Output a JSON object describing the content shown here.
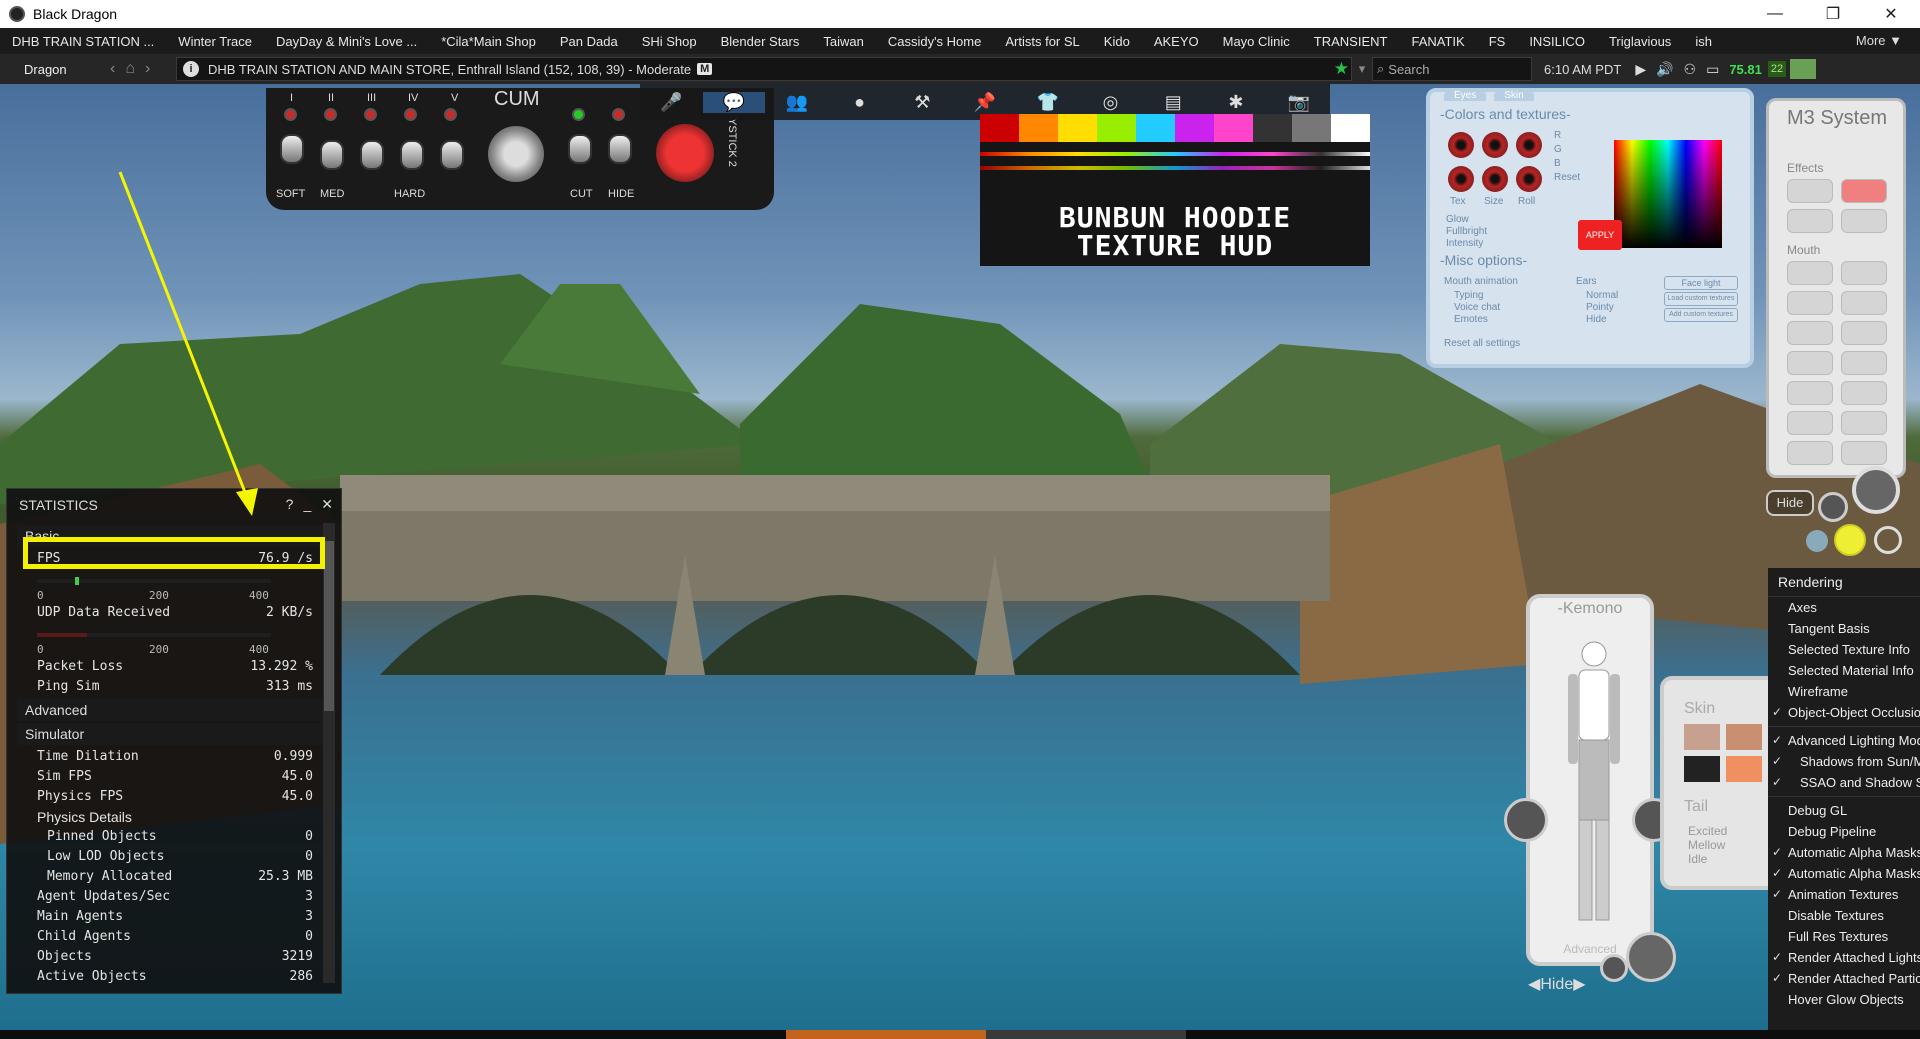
{
  "window": {
    "title": "Black Dragon",
    "controls": [
      "minimize",
      "maximize",
      "close"
    ]
  },
  "favorites": {
    "items": [
      "DHB TRAIN STATION ...",
      "Winter Trace",
      "DayDay & Mini's Love ...",
      "*Cila*Main Shop",
      "Pan Dada",
      "SHi Shop",
      "Blender Stars",
      "Taiwan",
      "Cassidy's Home",
      "Artists for SL",
      "Kido",
      "AKEYO",
      "Mayo Clinic",
      "TRANSIENT",
      "FANATIK",
      "FS",
      "INSILICO",
      "Triglavious",
      "ish"
    ],
    "more_label": "More ▼"
  },
  "navbar": {
    "user": "Dragon",
    "location": "DHB TRAIN STATION AND MAIN STORE, Enthrall Island (152, 108, 39) - Moderate",
    "maturity_badge": "M",
    "search_placeholder": "Search",
    "time": "6:10 AM PDT",
    "fps_value": "75.81",
    "ping_value": "22"
  },
  "hud_left": {
    "labels_top": [
      "I",
      "II",
      "III",
      "IV",
      "V"
    ],
    "cum_label": "CUM",
    "bottom_labels": [
      "SOFT",
      "MED",
      "HARD",
      "CUT",
      "HIDE"
    ],
    "side_label": "YSTICK 2"
  },
  "texture_hud": {
    "title_line1": "BUNBUN HOODIE",
    "title_line2": "TEXTURE HUD"
  },
  "eyes_hud": {
    "tabs": [
      "Eyes",
      "Skin"
    ],
    "colors_title": "-Colors and textures-",
    "rgb": [
      "R",
      "G",
      "B"
    ],
    "reset": "Reset",
    "labels": [
      "Tex",
      "Size",
      "Roll"
    ],
    "options": [
      "Glow",
      "Fullbright",
      "Intensity"
    ],
    "apply": "APPLY",
    "misc_title": "-Misc options-",
    "mouth_anim": "Mouth animation",
    "mouth_opts": [
      "Typing",
      "Voice chat",
      "Emotes"
    ],
    "ears": "Ears",
    "ears_opts": [
      "Normal",
      "Pointy",
      "Hide"
    ],
    "buttons": [
      "Face light",
      "Load custom textures",
      "Add custom textures"
    ],
    "reset_all": "Reset all settings"
  },
  "m3hud": {
    "title": "M3 System",
    "effects": "Effects",
    "mouth": "Mouth",
    "hide": "Hide"
  },
  "bodyhud": {
    "title": "-Kemono",
    "advanced": "Advanced",
    "hide": "Hide"
  },
  "skinhud": {
    "skin": "Skin",
    "tail": "Tail",
    "tail_opts": [
      "Excited",
      "Mellow",
      "Idle"
    ]
  },
  "statistics": {
    "title": "STATISTICS",
    "groups": {
      "basic": "Basic",
      "advanced": "Advanced",
      "simulator": "Simulator",
      "physics_details": "Physics Details"
    },
    "fps": {
      "label": "FPS",
      "value": "76.9 /s",
      "ticks": [
        "0",
        "200",
        "400"
      ]
    },
    "udp": {
      "label": "UDP Data Received",
      "value": "2 KB/s",
      "ticks": [
        "0",
        "200",
        "400"
      ]
    },
    "basic_rows": [
      {
        "label": "Packet Loss",
        "value": "13.292 %"
      },
      {
        "label": "Ping Sim",
        "value": "313 ms"
      }
    ],
    "sim_rows": [
      {
        "label": "Time Dilation",
        "value": "0.999"
      },
      {
        "label": "Sim FPS",
        "value": "45.0"
      },
      {
        "label": "Physics FPS",
        "value": "45.0"
      }
    ],
    "physics_rows": [
      {
        "label": "Pinned Objects",
        "value": "0"
      },
      {
        "label": "Low LOD Objects",
        "value": "0"
      },
      {
        "label": "Memory Allocated",
        "value": "25.3 MB"
      }
    ],
    "agent_rows": [
      {
        "label": "Agent Updates/Sec",
        "value": "3"
      },
      {
        "label": "Main Agents",
        "value": "3"
      },
      {
        "label": "Child Agents",
        "value": "0"
      },
      {
        "label": "Objects",
        "value": "3219"
      },
      {
        "label": "Active Objects",
        "value": "286"
      }
    ]
  },
  "render_menu": {
    "title": "Rendering",
    "items": [
      {
        "label": "Axes",
        "checked": false,
        "sub": false
      },
      {
        "label": "Tangent Basis",
        "checked": false,
        "sub": false
      },
      {
        "label": "Selected Texture Info",
        "checked": false,
        "sub": false
      },
      {
        "label": "Selected Material Info",
        "checked": false,
        "sub": false
      },
      {
        "label": "Wireframe",
        "checked": false,
        "sub": false
      },
      {
        "label": "Object-Object Occlusion",
        "checked": true,
        "sub": false
      },
      {
        "label": "Advanced Lighting Model",
        "checked": true,
        "sub": false
      },
      {
        "label": "Shadows from Sun/Moon",
        "checked": true,
        "sub": true
      },
      {
        "label": "SSAO and Shadow Smoothing",
        "checked": true,
        "sub": true
      },
      {
        "label": "Debug GL",
        "checked": false,
        "sub": false
      },
      {
        "label": "Debug Pipeline",
        "checked": false,
        "sub": false
      },
      {
        "label": "Automatic Alpha Masks (deferred)",
        "checked": true,
        "sub": false
      },
      {
        "label": "Automatic Alpha Masks (non-deferred)",
        "checked": true,
        "sub": false
      },
      {
        "label": "Animation Textures",
        "checked": true,
        "sub": false
      },
      {
        "label": "Disable Textures",
        "checked": false,
        "sub": false
      },
      {
        "label": "Full Res Textures",
        "checked": false,
        "sub": false
      },
      {
        "label": "Render Attached Lights",
        "checked": true,
        "sub": false
      },
      {
        "label": "Render Attached Particles",
        "checked": true,
        "sub": false
      },
      {
        "label": "Hover Glow Objects",
        "checked": false,
        "sub": false
      }
    ]
  },
  "colors": {
    "highlight": "#f2f200",
    "fps_green": "#3fe04f",
    "accent_red": "#e22222"
  }
}
